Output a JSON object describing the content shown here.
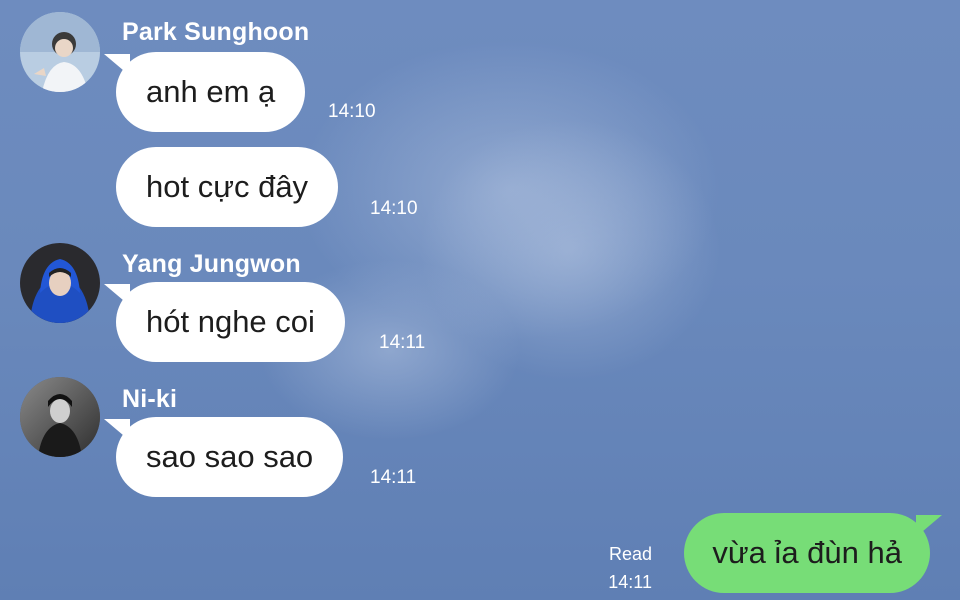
{
  "colors": {
    "background": "#6a89bc",
    "incoming_bubble": "#ffffff",
    "outgoing_bubble": "#77dd77",
    "text": "#1d1d1d",
    "meta_text": "#ffffff"
  },
  "messages": [
    {
      "sender": "Park Sunghoon",
      "avatar": "avatar-park-sunghoon",
      "text": "anh em ạ",
      "time": "14:10"
    },
    {
      "sender": "",
      "avatar": "",
      "text": "hot cực đây",
      "time": "14:10"
    },
    {
      "sender": "Yang Jungwon",
      "avatar": "avatar-yang-jungwon",
      "text": "hót nghe coi",
      "time": "14:11"
    },
    {
      "sender": "Ni-ki",
      "avatar": "avatar-ni-ki",
      "text": "sao sao sao",
      "time": "14:11"
    }
  ],
  "outgoing": {
    "text": "vừa ỉa đùn hả",
    "status": "Read",
    "time": "14:11"
  }
}
